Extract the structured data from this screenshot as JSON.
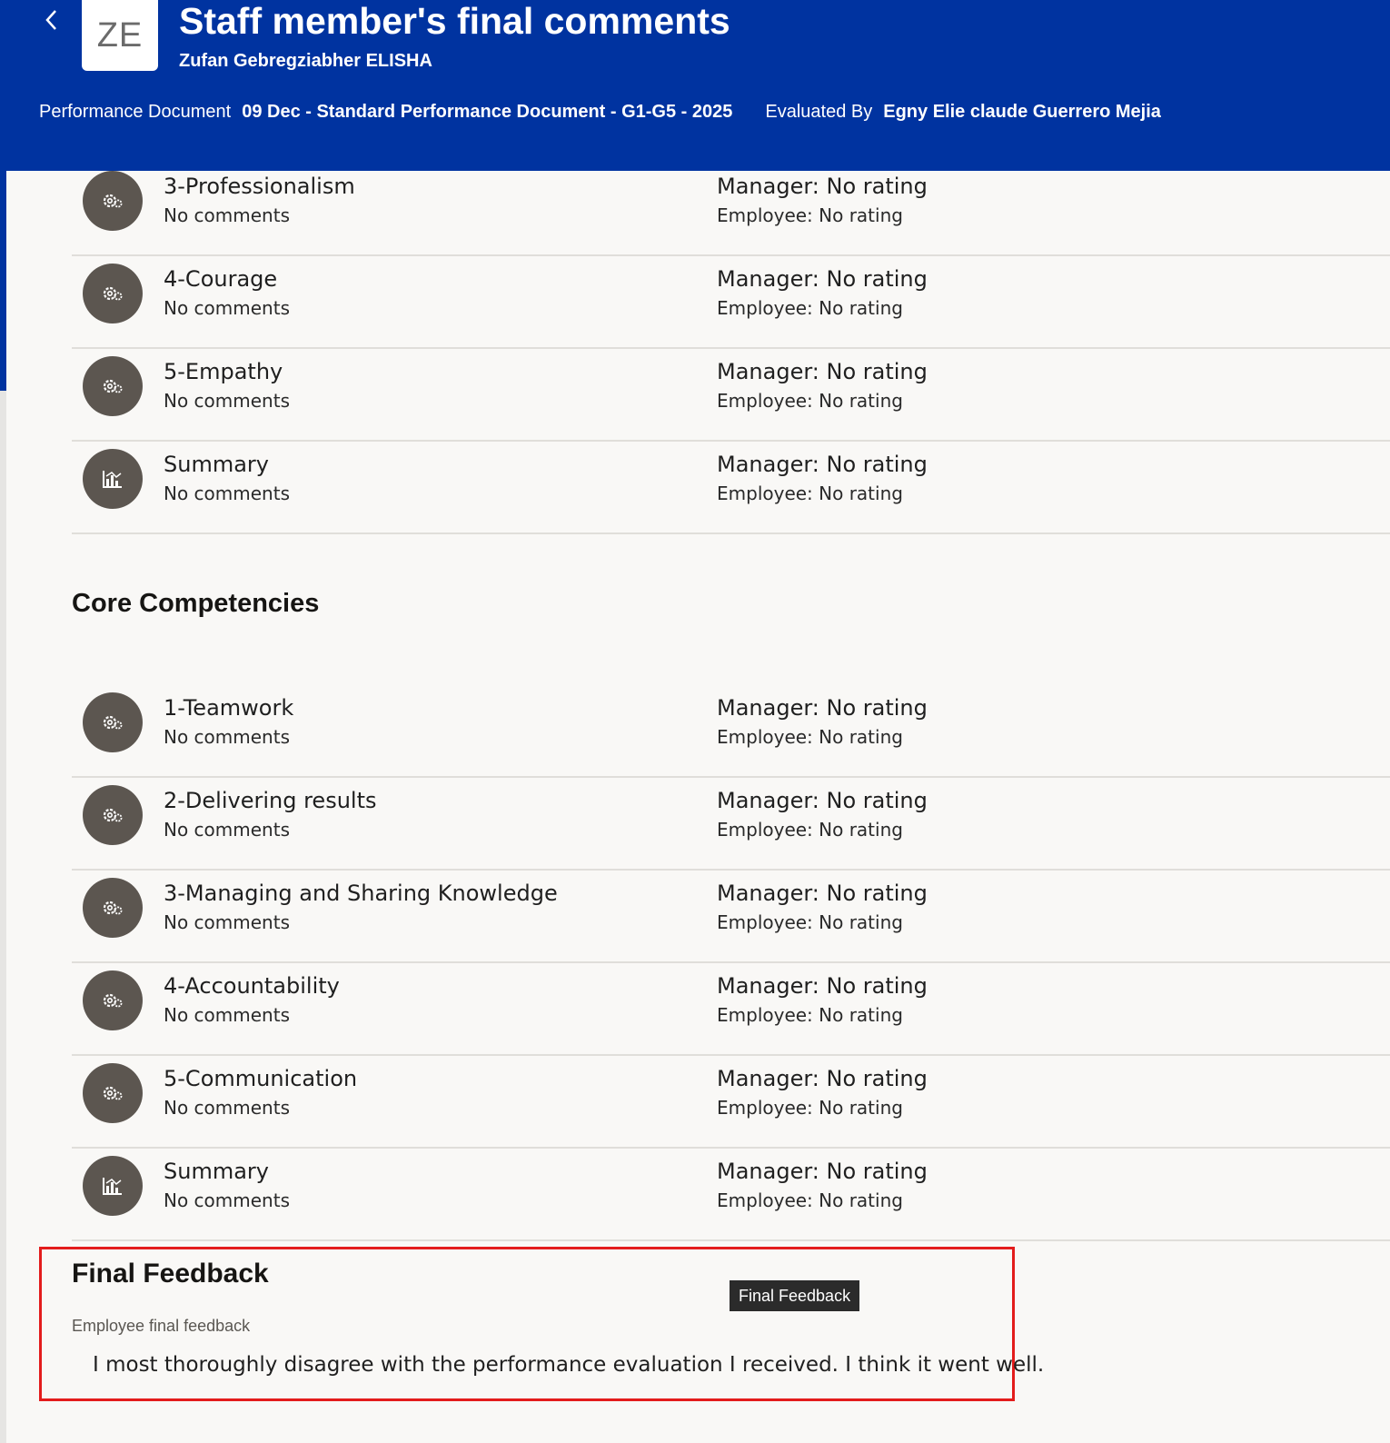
{
  "header": {
    "title": "Staff member's final comments",
    "avatar_initials": "ZE",
    "person_name": "Zufan Gebregziabher ELISHA",
    "performance_document_label": "Performance Document",
    "performance_document_value": "09 Dec - Standard Performance Document - G1-G5 - 2025",
    "evaluated_by_label": "Evaluated By",
    "evaluated_by_value": "Egny Elie claude Guerrero Mejia"
  },
  "values_section": {
    "items": [
      {
        "title": "3-Professionalism",
        "comments": "No comments",
        "manager": "Manager: No rating",
        "employee": "Employee: No rating",
        "icon": "gear-icon"
      },
      {
        "title": "4-Courage",
        "comments": "No comments",
        "manager": "Manager: No rating",
        "employee": "Employee: No rating",
        "icon": "gear-icon"
      },
      {
        "title": "5-Empathy",
        "comments": "No comments",
        "manager": "Manager: No rating",
        "employee": "Employee: No rating",
        "icon": "gear-icon"
      },
      {
        "title": "Summary",
        "comments": "No comments",
        "manager": "Manager: No rating",
        "employee": "Employee: No rating",
        "icon": "chart-icon"
      }
    ]
  },
  "core_competencies": {
    "title": "Core Competencies",
    "items": [
      {
        "title": "1-Teamwork",
        "comments": "No comments",
        "manager": "Manager: No rating",
        "employee": "Employee: No rating",
        "icon": "gear-icon"
      },
      {
        "title": "2-Delivering results",
        "comments": "No comments",
        "manager": "Manager: No rating",
        "employee": "Employee: No rating",
        "icon": "gear-icon"
      },
      {
        "title": "3-Managing and Sharing Knowledge",
        "comments": "No comments",
        "manager": "Manager: No rating",
        "employee": "Employee: No rating",
        "icon": "gear-icon"
      },
      {
        "title": "4-Accountability",
        "comments": "No comments",
        "manager": "Manager: No rating",
        "employee": "Employee: No rating",
        "icon": "gear-icon"
      },
      {
        "title": "5-Communication",
        "comments": "No comments",
        "manager": "Manager: No rating",
        "employee": "Employee: No rating",
        "icon": "gear-icon"
      },
      {
        "title": "Summary",
        "comments": "No comments",
        "manager": "Manager: No rating",
        "employee": "Employee: No rating",
        "icon": "chart-icon"
      }
    ]
  },
  "final_feedback": {
    "title": "Final Feedback",
    "badge": "Final Feedback",
    "label": "Employee final feedback",
    "text": "I most thoroughly disagree with the performance evaluation I received. I think it went well."
  },
  "colors": {
    "header_bg": "#0033a0",
    "highlight_border": "#e31c1c",
    "icon_bg": "#5c5650",
    "content_bg": "#f9f8f6"
  }
}
